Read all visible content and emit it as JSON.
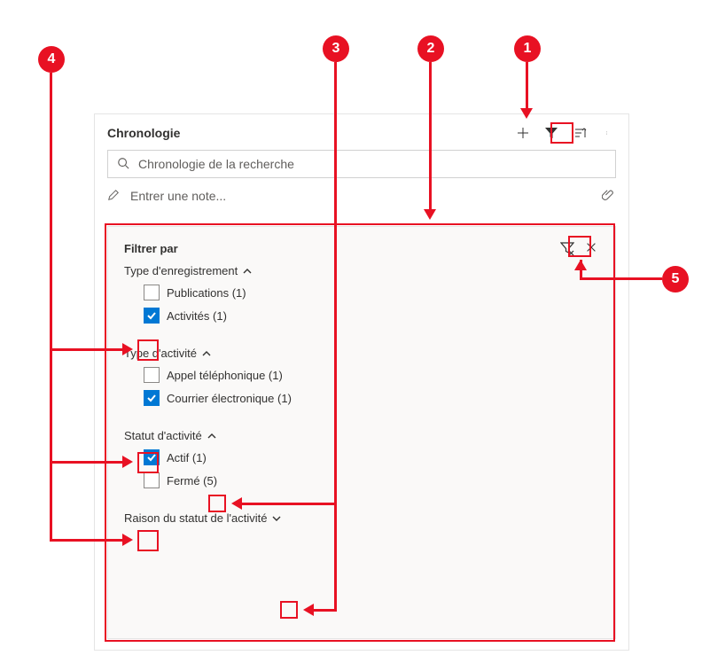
{
  "timeline": {
    "title": "Chronologie",
    "search_placeholder": "Chronologie de la recherche",
    "note_placeholder": "Entrer une note..."
  },
  "filter": {
    "title": "Filtrer par",
    "sections": {
      "record_type": {
        "label": "Type d'enregistrement",
        "options": [
          {
            "label": "Publications (1)",
            "checked": false
          },
          {
            "label": "Activités (1)",
            "checked": true
          }
        ]
      },
      "activity_type": {
        "label": "Type d'activité",
        "options": [
          {
            "label": "Appel téléphonique (1)",
            "checked": false
          },
          {
            "label": "Courrier électronique (1)",
            "checked": true
          }
        ]
      },
      "activity_status": {
        "label": "Statut d'activité",
        "options": [
          {
            "label": "Actif (1)",
            "checked": true
          },
          {
            "label": "Fermé (5)",
            "checked": false
          }
        ]
      },
      "status_reason": {
        "label": "Raison du statut de l'activité"
      }
    }
  },
  "callouts": {
    "n1": "1",
    "n2": "2",
    "n3": "3",
    "n4": "4",
    "n5": "5"
  }
}
